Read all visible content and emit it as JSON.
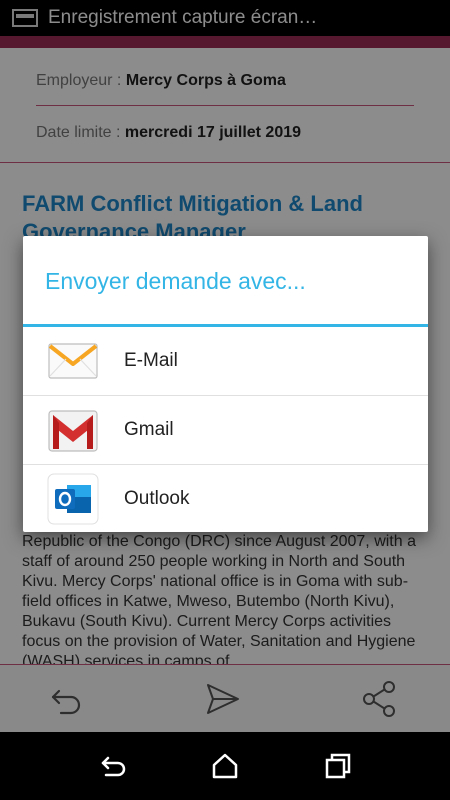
{
  "status_bar": {
    "title": "Enregistrement capture écran…",
    "icon": "screen-record-icon"
  },
  "accent_color": "#9c2c55",
  "job": {
    "employer_label": "Employeur : ",
    "employer": "Mercy Corps à Goma",
    "deadline_label": "Date limite : ",
    "deadline": "mercredi 17 juillet 2019",
    "title": "FARM Conflict Mitigation & Land Governance Manager",
    "description": "Republic of the Congo (DRC) since August 2007, with a staff of around 250 people working in North and South Kivu. Mercy Corps' national office is in Goma with sub-field offices in Katwe, Mweso, Butembo (North Kivu), Bukavu (South Kivu). Current Mercy Corps activities focus on the provision of Water, Sanitation and Hygiene (WASH) services in camps of"
  },
  "dialog": {
    "title": "Envoyer demande avec...",
    "accent": "#33b5e5",
    "options": [
      {
        "label": "E-Mail",
        "icon": "email-envelope-icon"
      },
      {
        "label": "Gmail",
        "icon": "gmail-icon"
      },
      {
        "label": "Outlook",
        "icon": "outlook-icon"
      }
    ]
  },
  "toolbar": {
    "icons": [
      "back-arrow-icon",
      "send-icon",
      "share-icon"
    ]
  },
  "nav": {
    "icons": [
      "nav-back-icon",
      "home-icon",
      "recent-apps-icon"
    ]
  }
}
